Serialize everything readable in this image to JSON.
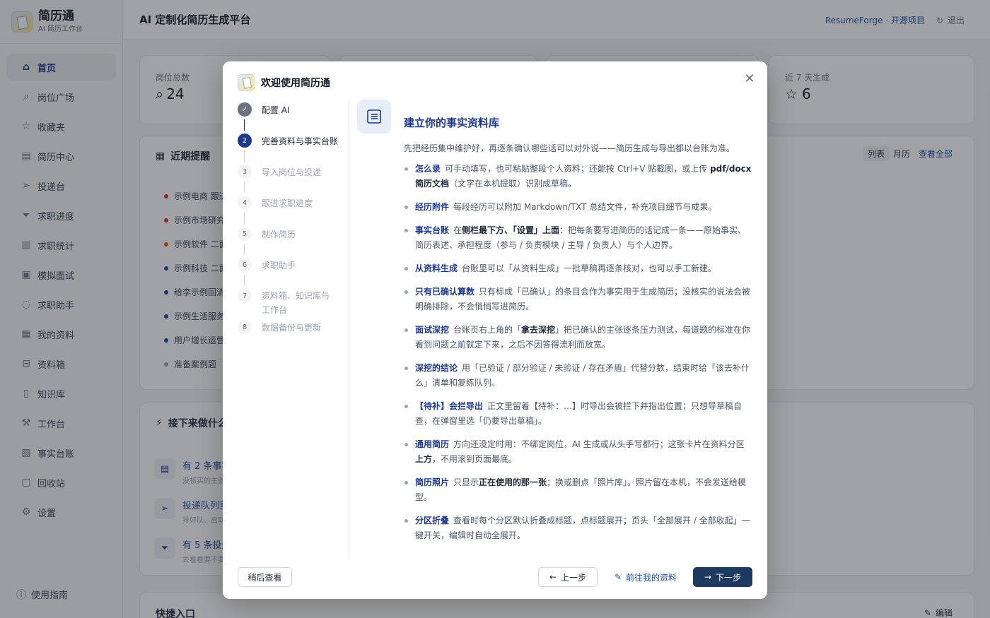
{
  "brand": {
    "name": "简历通",
    "subtitle": "AI 简历工作台"
  },
  "sidebar": {
    "items": [
      {
        "label": "首页",
        "icon": "home-icon",
        "glyph": "⌂",
        "active": true
      },
      {
        "label": "岗位广场",
        "icon": "search-icon",
        "glyph": "⌕"
      },
      {
        "label": "收藏夹",
        "icon": "star-icon",
        "glyph": "☆"
      },
      {
        "label": "简历中心",
        "icon": "file-icon",
        "glyph": "▤"
      },
      {
        "label": "投递台",
        "icon": "send-icon",
        "glyph": "➢"
      },
      {
        "label": "求职进度",
        "icon": "funnel-icon",
        "glyph": "⏷"
      },
      {
        "label": "求职统计",
        "icon": "bar-chart-icon",
        "glyph": "▥"
      },
      {
        "label": "模拟面试",
        "icon": "clipboard-icon",
        "glyph": "▣"
      },
      {
        "label": "求职助手",
        "icon": "chat-icon",
        "glyph": "◌"
      },
      {
        "label": "我的资料",
        "icon": "profile-icon",
        "glyph": "▦"
      },
      {
        "label": "资料箱",
        "icon": "inbox-icon",
        "glyph": "⊟"
      },
      {
        "label": "知识库",
        "icon": "book-icon",
        "glyph": "▯"
      },
      {
        "label": "工作台",
        "icon": "wrench-icon",
        "glyph": "⚒"
      },
      {
        "label": "事实台账",
        "icon": "ledger-icon",
        "glyph": "▧"
      },
      {
        "label": "回收站",
        "icon": "trash-icon",
        "glyph": "▢"
      },
      {
        "label": "设置",
        "icon": "gear-icon",
        "glyph": "⚙"
      }
    ],
    "guide": "使用指南"
  },
  "header": {
    "title": "AI 定制化简历生成平台",
    "link": "ResumeForge · 开源项目",
    "logout": "退出"
  },
  "stats": {
    "jobs_label": "岗位总数",
    "jobs_value": "24",
    "recent_label": "近 7 天生成",
    "recent_value": "6"
  },
  "reminders": {
    "title": "近期提醒",
    "view_list": "列表",
    "view_month": "月历",
    "view_all": "查看全部",
    "items": [
      {
        "text": "示例电商 跟进",
        "color": "#dc2626"
      },
      {
        "text": "示例市场研究",
        "color": "#dc2626"
      },
      {
        "text": "示例软件 二面",
        "color": "#ea580c"
      },
      {
        "text": "示例科技 二面",
        "color": "#1e40af"
      },
      {
        "text": "给李示例回消息",
        "color": "#1e40af"
      },
      {
        "text": "示例生活服务",
        "color": "#1e40af"
      },
      {
        "text": "用户增长运营",
        "color": "#1e40af"
      },
      {
        "text": "准备案例题",
        "color": "#9ca3af"
      }
    ]
  },
  "next": {
    "title": "接下来做什么",
    "items": [
      {
        "title": "有 2 条事实",
        "sub": "没核实的主张",
        "glyph": "▤"
      },
      {
        "title": "投递队列里",
        "sub": "排好队、启动",
        "glyph": "➢"
      },
      {
        "title": "有 5 条投递",
        "sub": "去看看要不要",
        "glyph": "⏷"
      }
    ]
  },
  "quick": {
    "title": "快捷入口",
    "edit": "编辑"
  },
  "modal": {
    "title": "欢迎使用简历通",
    "steps": [
      {
        "num": "✓",
        "label": "配置 AI",
        "state": "done"
      },
      {
        "num": "2",
        "label": "完善资料与事实台账",
        "state": "current"
      },
      {
        "num": "3",
        "label": "导入岗位与投递",
        "state": "todo"
      },
      {
        "num": "4",
        "label": "跟进求职进度",
        "state": "todo"
      },
      {
        "num": "5",
        "label": "制作简历",
        "state": "todo"
      },
      {
        "num": "6",
        "label": "求职助手",
        "state": "todo"
      },
      {
        "num": "7",
        "label": "资料箱、知识库与工作台",
        "state": "todo"
      },
      {
        "num": "8",
        "label": "数据备份与更新",
        "state": "todo"
      }
    ],
    "content_title": "建立你的事实资料库",
    "intro": "先把经历集中维护好，再逐条确认哪些话可以对外说——简历生成与导出都以台账为准。",
    "bullets": [
      {
        "kw": "怎么录",
        "parts": [
          "可手动填写，也可粘贴整段个人资料；还能按 Ctrl+V 贴截图，或上传 ",
          "pdf/docx 简历文档",
          "（文字在本机提取）识别成草稿。"
        ]
      },
      {
        "kw": "经历附件",
        "parts": [
          "每段经历可以附加 Markdown/TXT 总结文件，补充项目细节与成果。",
          "",
          ""
        ]
      },
      {
        "kw": "事实台账",
        "parts": [
          "在",
          "侧栏最下方、「设置」上面",
          "：把每条要写进简历的话记成一条——原始事实、简历表述、承担程度（参与 / 负责模块 / 主导 / 负责人）与个人边界。"
        ]
      },
      {
        "kw": "从资料生成",
        "parts": [
          "台账里可以「从资料生成」一批草稿再逐条核对，也可以手工新建。",
          "",
          ""
        ]
      },
      {
        "kw": "只有已确认算数",
        "parts": [
          "只有标成「已确认」的条目会作为事实用于生成简历；没核实的说法会被明确排除，不会悄悄写进简历。",
          "",
          ""
        ]
      },
      {
        "kw": "面试深挖",
        "parts": [
          "台账页右上角的「",
          "拿去深挖",
          "」把已确认的主张逐条压力测试，每道题的标准在你看到问题之前就定下来，之后不因答得流利而放宽。"
        ]
      },
      {
        "kw": "深挖的结论",
        "parts": [
          "用「已验证 / 部分验证 / 未验证 / 存在矛盾」代替分数，结束时给「该去补什么」清单和复练队列。",
          "",
          ""
        ]
      },
      {
        "kw": "【待补】会拦导出",
        "parts": [
          "正文里留着【待补：…】时导出会被拦下并指出位置；只想导草稿自查，在弹窗里选「仍要导出草稿」。",
          "",
          ""
        ]
      },
      {
        "kw": "通用简历",
        "parts": [
          "方向还没定时用：不绑定岗位，AI 生成或从头手写都行；这张卡片在资料分区",
          "上方",
          "，不用滚到页面最底。"
        ]
      },
      {
        "kw": "简历照片",
        "parts": [
          "只显示",
          "正在使用的那一张",
          "；换或删点「照片库」。照片留在本机，不会发送给模型。"
        ]
      },
      {
        "kw": "分区折叠",
        "parts": [
          "查看时每个分区默认折叠成标题，点标题展开；页头「全部展开 / 全部收起」一键开关，编辑时自动全展开。",
          "",
          ""
        ]
      }
    ],
    "btn_later": "稍后查看",
    "btn_prev": "上一步",
    "btn_goto": "前往我的资料",
    "btn_next": "下一步"
  }
}
